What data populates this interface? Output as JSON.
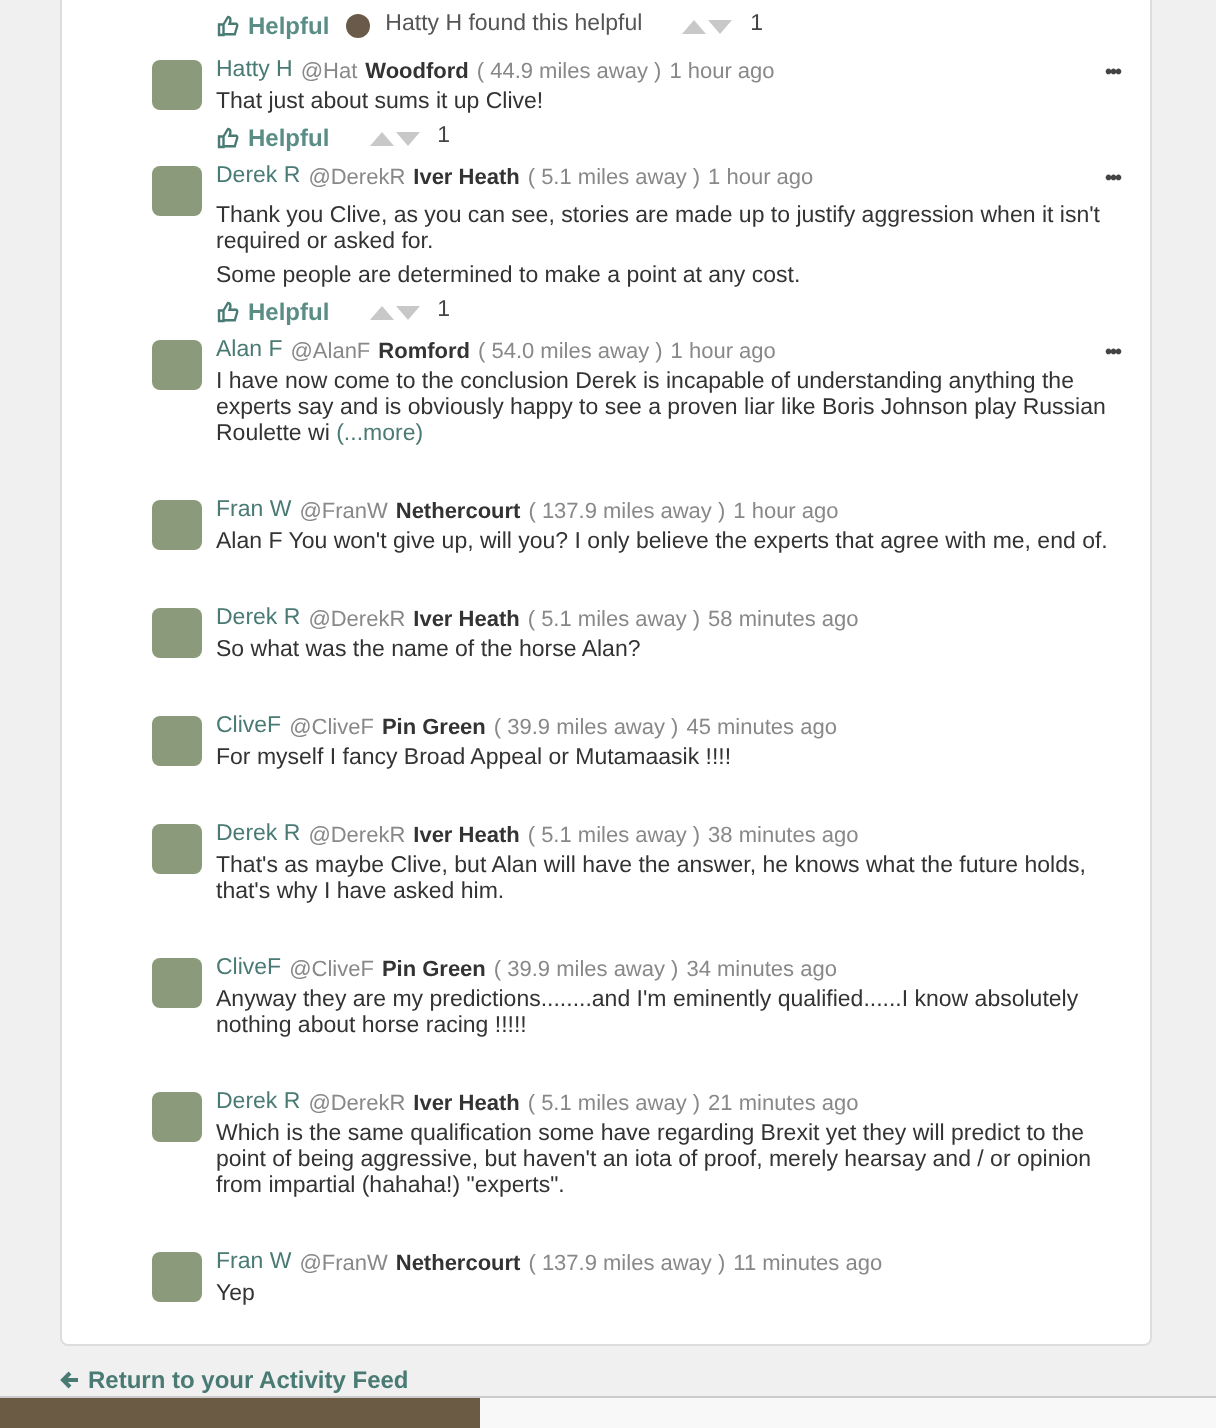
{
  "previous_comment_footer": {
    "helpful_label": "Helpful",
    "found_helpful": "Hatty H found this helpful",
    "votes": "1"
  },
  "comments": [
    {
      "name": "Hatty H",
      "handle": "@Hat",
      "location": "Woodford",
      "distance": "( 44.9 miles away )",
      "time": "1 hour ago",
      "menu": "•••",
      "paragraphs": [
        "That just about sums it up Clive!"
      ],
      "helpful": {
        "label": "Helpful",
        "votes": "1"
      }
    },
    {
      "name": "Derek R",
      "handle": "@DerekR",
      "location": "Iver Heath",
      "distance": "( 5.1 miles away )",
      "time": "1 hour ago",
      "menu": "•••",
      "paragraphs": [
        "Thank you Clive, as you can see, stories are made up to justify aggression when it isn't required or asked for.",
        "Some people are determined to make a point at any cost."
      ],
      "helpful": {
        "label": "Helpful",
        "votes": "1"
      }
    },
    {
      "name": "Alan F",
      "handle": "@AlanF",
      "location": "Romford",
      "distance": "( 54.0 miles away )",
      "time": "1 hour ago",
      "menu": "•••",
      "paragraphs": [
        "I have now come to the conclusion Derek is incapable of understanding anything the experts say and is obviously happy to see a proven liar like Boris Johnson play Russian Roulette wi"
      ],
      "more": "(...more)"
    },
    {
      "name": "Fran W",
      "handle": "@FranW",
      "location": "Nethercourt",
      "distance": "( 137.9 miles away )",
      "time": "1 hour ago",
      "paragraphs": [
        "Alan F You won't give up, will you? I only believe the experts that agree with me, end of."
      ]
    },
    {
      "name": "Derek R",
      "handle": "@DerekR",
      "location": "Iver Heath",
      "distance": "( 5.1 miles away )",
      "time": "58 minutes ago",
      "paragraphs": [
        "So what was the name of the horse Alan?"
      ]
    },
    {
      "name": "CliveF",
      "handle": "@CliveF",
      "location": "Pin Green",
      "distance": "( 39.9 miles away )",
      "time": "45 minutes ago",
      "paragraphs": [
        "For myself I fancy Broad Appeal or Mutamaasik !!!!"
      ]
    },
    {
      "name": "Derek R",
      "handle": "@DerekR",
      "location": "Iver Heath",
      "distance": "( 5.1 miles away )",
      "time": "38 minutes ago",
      "paragraphs": [
        "That's as maybe Clive, but Alan will have the answer, he knows what the future holds, that's why I have asked him."
      ]
    },
    {
      "name": "CliveF",
      "handle": "@CliveF",
      "location": "Pin Green",
      "distance": "( 39.9 miles away )",
      "time": "34 minutes ago",
      "paragraphs": [
        "Anyway they are my predictions........and I'm eminently qualified......I know absolutely nothing about horse racing !!!!!"
      ]
    },
    {
      "name": "Derek R",
      "handle": "@DerekR",
      "location": "Iver Heath",
      "distance": "( 5.1 miles away )",
      "time": "21 minutes ago",
      "paragraphs": [
        "Which is the same qualification some have regarding Brexit yet they will predict to the point of being aggressive, but haven't an iota of proof, merely hearsay and / or opinion from impartial (hahaha!) \"experts\"."
      ]
    },
    {
      "name": "Fran W",
      "handle": "@FranW",
      "location": "Nethercourt",
      "distance": "( 137.9 miles away )",
      "time": "11 minutes ago",
      "paragraphs": [
        "Yep"
      ]
    }
  ],
  "return_link": "Return to your Activity Feed"
}
